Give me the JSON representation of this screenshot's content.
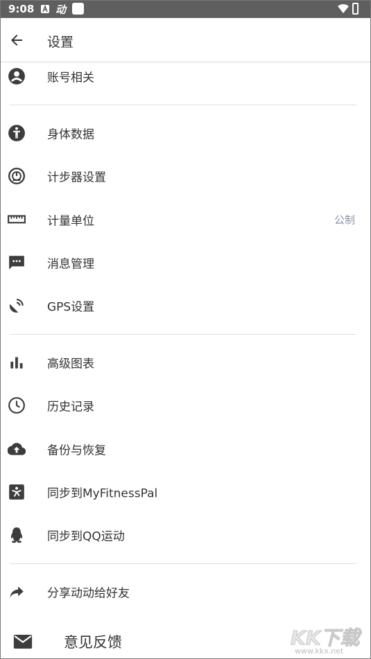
{
  "status_bar": {
    "time": "9:08",
    "notif_text": "动",
    "icons": [
      "a-icon",
      "dong-icon",
      "white-square-icon",
      "wifi-icon",
      "battery-icon"
    ]
  },
  "header": {
    "title": "设置",
    "back_icon": "arrow-left-icon"
  },
  "sections": {
    "account": {
      "label": "账号相关",
      "icon": "account-circle-icon"
    },
    "body_data": {
      "label": "身体数据",
      "icon": "person-icon"
    },
    "pedometer": {
      "label": "计步器设置",
      "icon": "speedometer-icon"
    },
    "units": {
      "label": "计量单位",
      "value": "公制",
      "icon": "ruler-icon"
    },
    "messages": {
      "label": "消息管理",
      "icon": "message-icon"
    },
    "gps": {
      "label": "GPS设置",
      "icon": "satellite-icon"
    },
    "charts": {
      "label": "高级图表",
      "icon": "bar-chart-icon"
    },
    "history": {
      "label": "历史记录",
      "icon": "clock-icon"
    },
    "backup": {
      "label": "备份与恢复",
      "icon": "cloud-upload-icon"
    },
    "mfp": {
      "label": "同步到MyFitnessPal",
      "icon": "myfitnesspal-icon"
    },
    "qq": {
      "label": "同步到QQ运动",
      "icon": "qq-penguin-icon"
    },
    "share": {
      "label": "分享动动给好友",
      "icon": "share-arrow-icon"
    },
    "feedback": {
      "label": "意见反馈",
      "icon": "mail-icon"
    }
  },
  "watermark": {
    "text": "KK下载",
    "url": "www.kkx.net"
  },
  "colors": {
    "status_bar": "#5f5f5f",
    "icon": "#3d3d3d",
    "value_text": "#8a94a6",
    "divider": "#dddddd"
  }
}
